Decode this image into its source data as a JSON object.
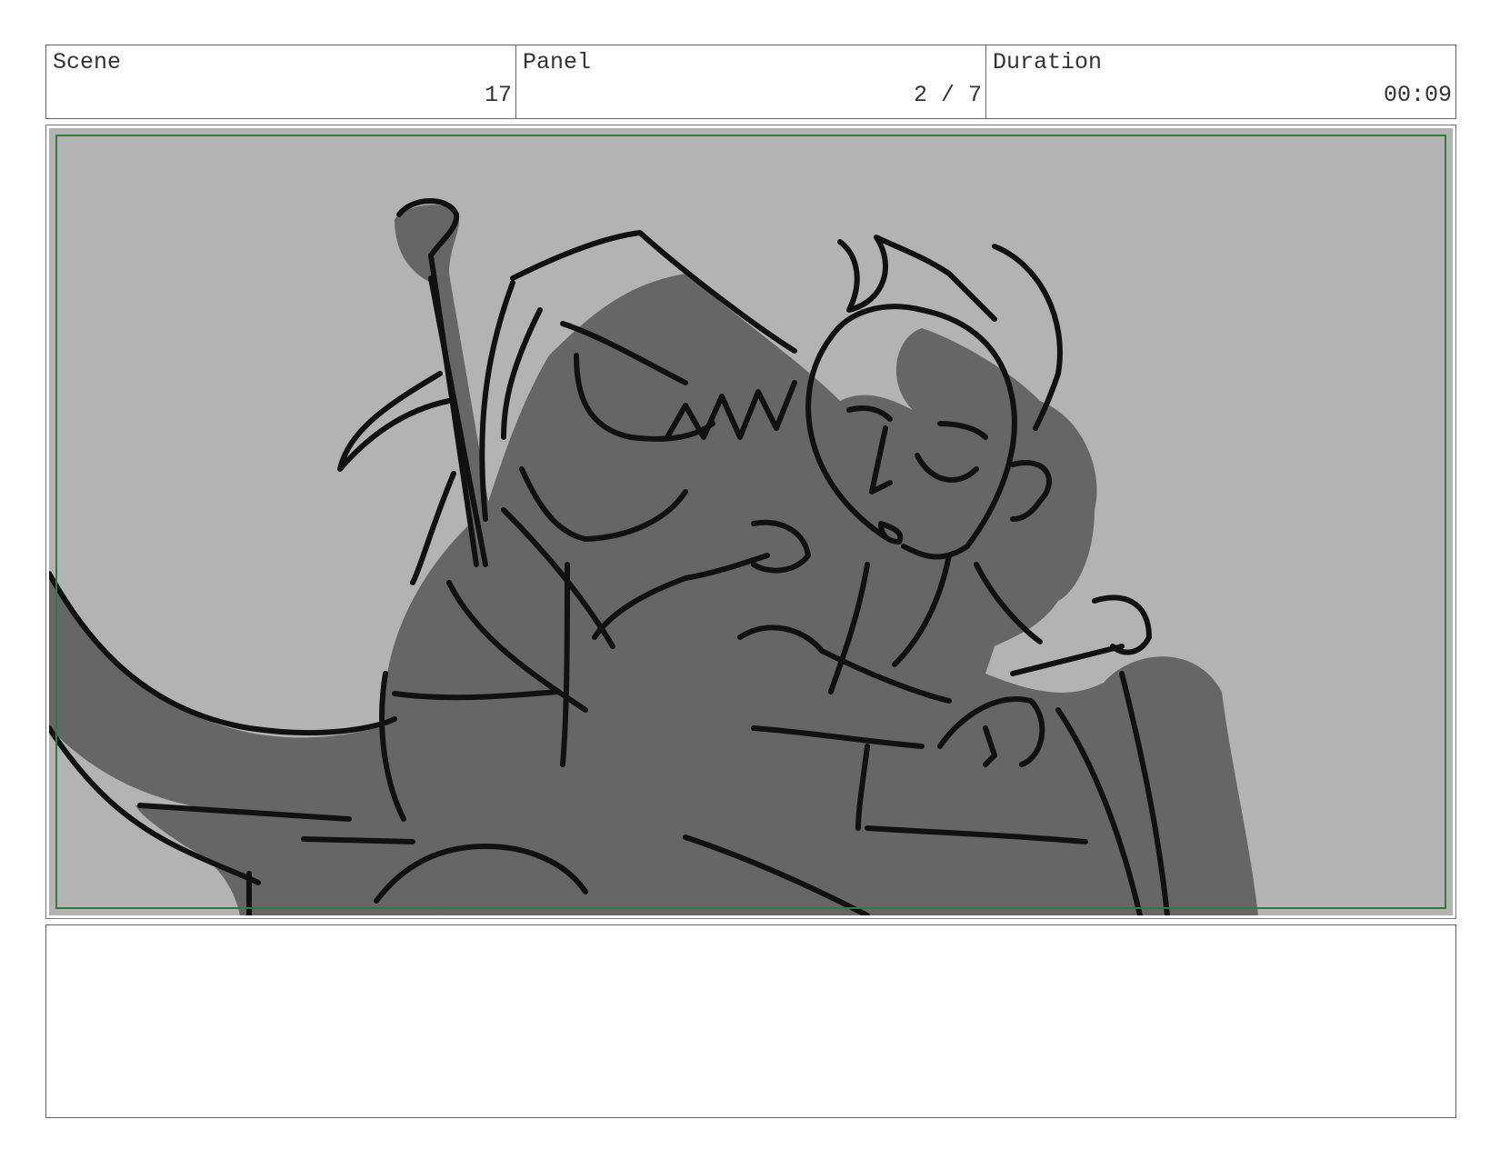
{
  "header": {
    "scene": {
      "label": "Scene",
      "value": "17"
    },
    "panel": {
      "label": "Panel",
      "value": "2 / 7"
    },
    "duration": {
      "label": "Duration",
      "value": "00:09"
    }
  },
  "colors": {
    "background_sky": "#b3b3b3",
    "character_fill": "#666666",
    "ink": "#111111",
    "safe_area_border": "#2e7d32"
  },
  "notes": {
    "text": ""
  }
}
